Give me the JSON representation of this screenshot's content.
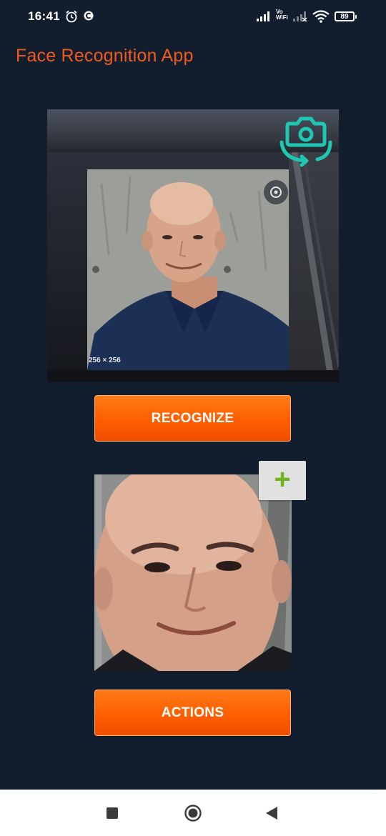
{
  "status_bar": {
    "time": "16:41",
    "network_label_top": "Vo",
    "network_label_bottom": "WiFi",
    "battery_level": "89",
    "icons": [
      "alarm-icon",
      "c-app-icon",
      "signal-icon",
      "vowifi-icon",
      "signal-icon-2",
      "wifi-icon",
      "battery-icon"
    ]
  },
  "app": {
    "title": "Face Recognition App",
    "title_color": "#f15a1e",
    "accent_color": "#ff6a00",
    "background_color": "#121d2e"
  },
  "camera_view": {
    "image_size_label": "256 × 256",
    "flip_camera_icon": "flip-camera-icon",
    "flip_camera_color": "#1fc7b3"
  },
  "buttons": {
    "recognize_label": "RECOGNIZE",
    "actions_label": "ACTIONS",
    "add_label": "+"
  },
  "nav_bar": {
    "icons": [
      "recent-apps-icon",
      "home-icon",
      "back-icon"
    ]
  }
}
